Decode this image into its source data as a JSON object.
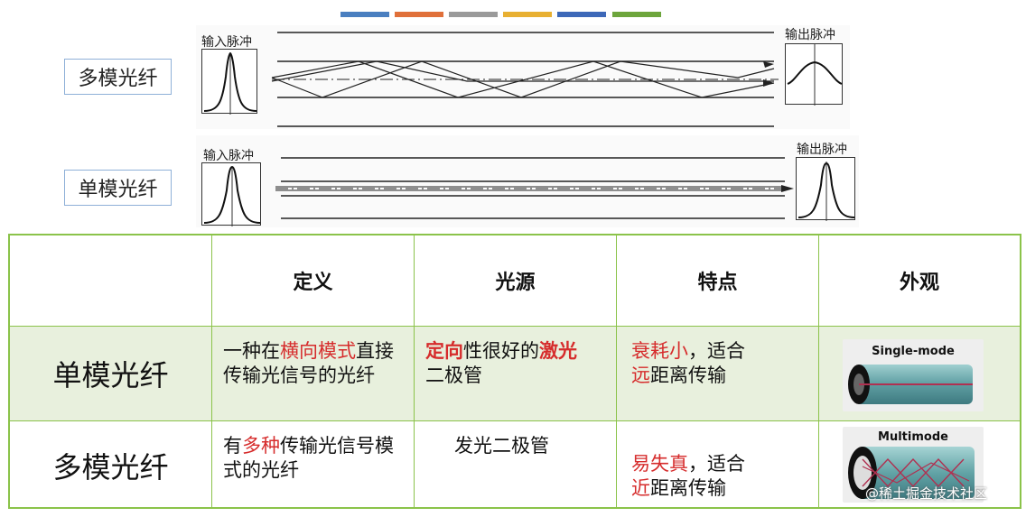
{
  "colors": {
    "bars": [
      "#4a7fc0",
      "#e0703a",
      "#9a9a9a",
      "#e8b032",
      "#3d68b8",
      "#6da53c"
    ],
    "table_border": "#8bc34a",
    "highlight_red": "#d62c2c",
    "row_green": "#e8f0dd"
  },
  "diagram_multi": {
    "label": "多模光纤",
    "input_label": "输入脉冲",
    "output_label": "输出脉冲"
  },
  "diagram_single": {
    "label": "单模光纤",
    "input_label": "输入脉冲",
    "output_label": "输出脉冲"
  },
  "table": {
    "headers": [
      "定义",
      "光源",
      "特点",
      "外观"
    ],
    "rows": [
      {
        "name": "单模光纤",
        "definition": {
          "a": "一种在",
          "b": "横向模式",
          "c": "直接传输光信号的光纤"
        },
        "source": {
          "a": "定向",
          "b": "性很好的",
          "c": "激光",
          "d": "二极管"
        },
        "feature": {
          "a": "衰耗小",
          "b": "，适合",
          "c": "远",
          "d": "距离传输"
        },
        "image_title": "Single-mode"
      },
      {
        "name": "多模光纤",
        "definition": {
          "a": "有",
          "b": "多种",
          "c": "传输光信号模式的光纤"
        },
        "source": {
          "a": "发光二极管"
        },
        "feature": {
          "a": "易失真",
          "b": "，适合",
          "c": "近",
          "d": "距离传输"
        },
        "image_title": "Multimode"
      }
    ]
  },
  "watermark": "@稀土掘金技术社区"
}
